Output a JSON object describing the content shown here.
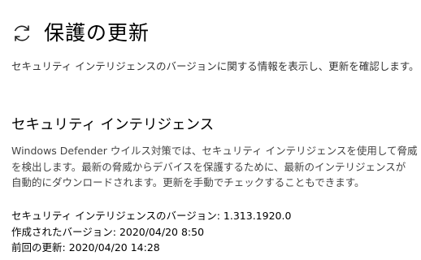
{
  "header": {
    "icon": "refresh-icon",
    "title": "保護の更新"
  },
  "description": "セキュリティ インテリジェンスのバージョンに関する情報を表示し、更新を確認します。",
  "section": {
    "title": "セキュリティ インテリジェンス",
    "body_lines": [
      "Windows Defender ウイルス対策では、セキュリティ インテリジェンスを使用して脅威",
      "を検出します。最新の脅威からデバイスを保護するために、最新のインテリジェンスが",
      "自動的にダウンロードされます。更新を手動でチェックすることもできます。"
    ]
  },
  "info": [
    {
      "label": "セキュリティ インテリジェンスのバージョン: ",
      "value": "1.313.1920.0"
    },
    {
      "label": "作成されたバージョン: ",
      "value": "2020/04/20 8:50"
    },
    {
      "label": "前回の更新: ",
      "value": "2020/04/20 14:28"
    }
  ]
}
